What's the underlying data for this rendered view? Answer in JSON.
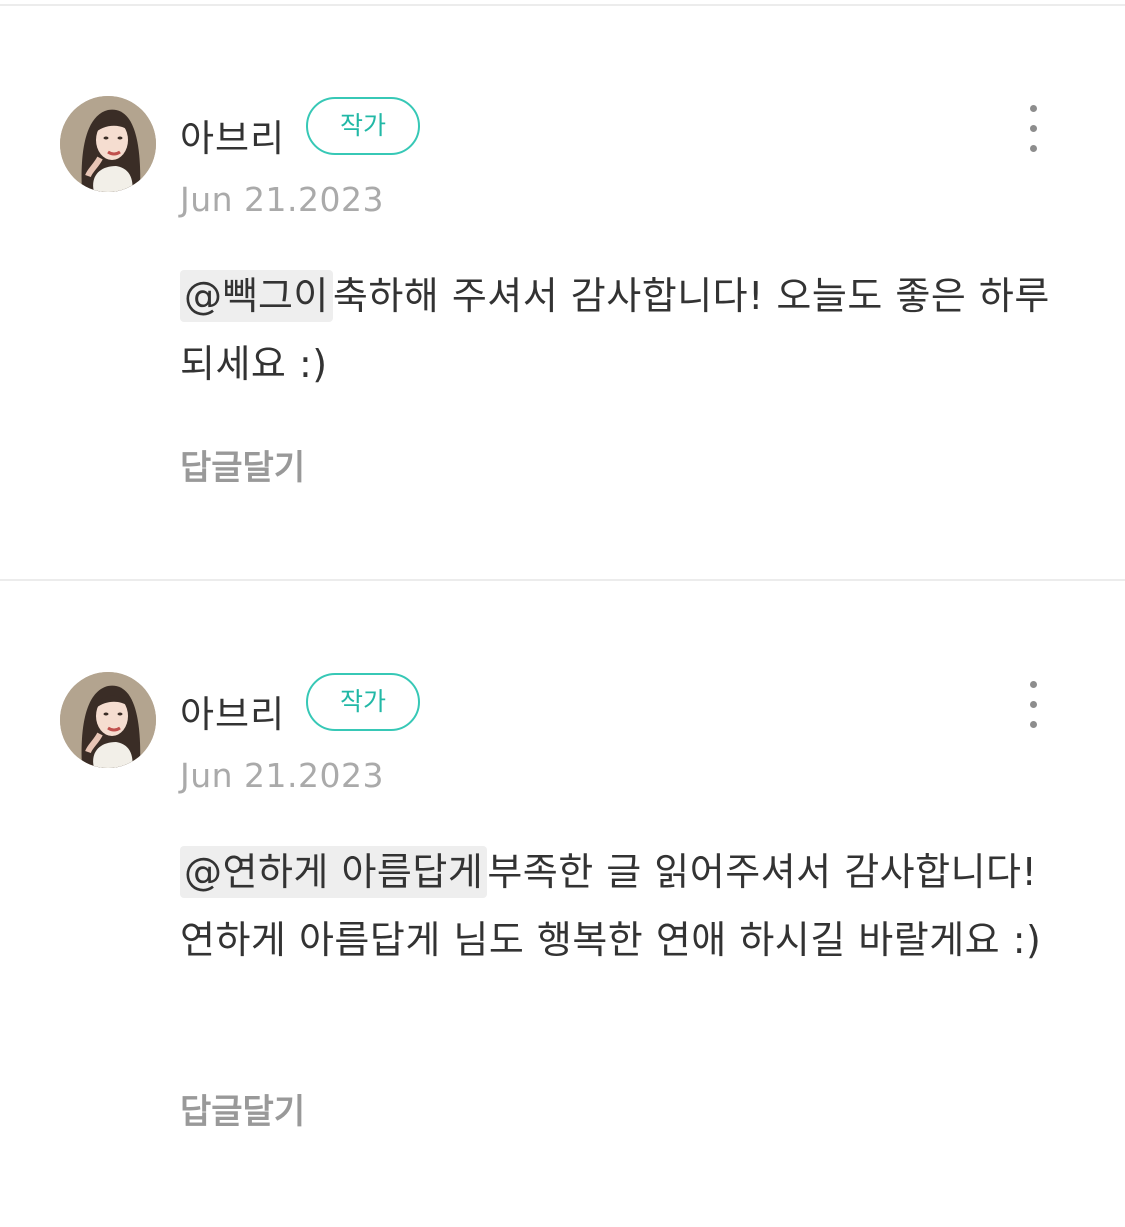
{
  "comments": [
    {
      "author": "아브리",
      "badge": "작가",
      "date": "Jun 21.2023",
      "mention": "@빽그이",
      "text": "축하해 주셔서 감사합니다! 오늘도 좋은 하루 되세요 :)",
      "reply_label": "답글달기",
      "avatar_icon": "avatar-illustration",
      "more_icon": "more-vertical-icon"
    },
    {
      "author": "아브리",
      "badge": "작가",
      "date": "Jun 21.2023",
      "mention": "@연하게 아름답게",
      "text": "부족한 글 읽어주셔서 감사합니다! 연하게 아름답게 님도 행복한 연애 하시길 바랄게요 :)",
      "reply_label": "답글달기",
      "avatar_icon": "avatar-illustration",
      "more_icon": "more-vertical-icon"
    }
  ],
  "colors": {
    "badge_accent": "#37c8b6",
    "text": "#333333",
    "muted": "#aaaaaa",
    "mention_bg": "#eeeeee",
    "divider": "#ececec"
  }
}
